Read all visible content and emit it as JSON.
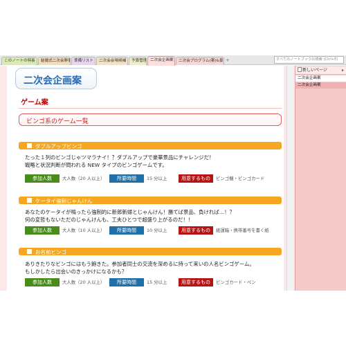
{
  "tabs": [
    {
      "label": "このノートの特長"
    },
    {
      "label": "結婚式二次会幹事"
    },
    {
      "label": "準備リスト"
    },
    {
      "label": "二次会会場候補"
    },
    {
      "label": "予算管理"
    },
    {
      "label": "二次会企画案"
    },
    {
      "label": "二次会プログラム(案)&景品"
    }
  ],
  "tab_add_icon": "+",
  "search_placeholder": "すべてのノートブックの検索 (Ctrl+E)",
  "page": {
    "title": "二次会企画案",
    "subheading": "ゲーム案",
    "section_title": "ビンゴ系のゲーム一覧"
  },
  "labels": {
    "people": "参加人数",
    "time": "所要時間",
    "items": "用意するもの"
  },
  "games": [
    {
      "title": "ダブルアップビンゴ",
      "desc1": "たった１列のビンゴじゃツマラナイ！？ダブルアップで豪華景品にチャレンジだ！",
      "desc2": "戦略と状況判断が問われる NEW タイプのビンゴゲームです。",
      "people": "大人数（20 人以上）",
      "time": "15 分以上",
      "items": "ビンゴ機・ビンゴカード"
    },
    {
      "title": "ケータイ強制じゃんけん",
      "desc1": "あなたのケータイが鳴ったら強制的に新郎新婦とじゃんけん！勝てば景品、負ければ…！？",
      "desc2": "何の変哲もないただのじゃんけんも、工夫ひとつで超盛り上がるのだ！！",
      "people": "大人数（10 人以上）",
      "time": "10 分以上",
      "items": "紙運箱・携帯番号を書く紙"
    },
    {
      "title": "お名前ビンゴ",
      "desc1": "ありきたりなビンゴにはもう飽きた。参加者同士の交流を深めるに持って来いの人名ビンゴゲーム。",
      "desc2": "もしかしたら出会いのきっかけになるかも？",
      "people": "大人数（20 人以上）",
      "time": "15 分以上",
      "items": "ビンゴカード・ペン"
    }
  ],
  "panel": {
    "new_page": "新しいページ",
    "new_page_arrow": "▸",
    "pages": [
      "二次会企画案",
      "二次会企画案"
    ]
  },
  "colors": {
    "tab_strip_pink": "#fce8e8",
    "section_orange": "#f7a622",
    "label_green": "#4a8c1c",
    "label_blue": "#1f6fa8",
    "label_red": "#b81313",
    "heading_red": "#cc0000",
    "title_blue": "#2b6bb0"
  }
}
